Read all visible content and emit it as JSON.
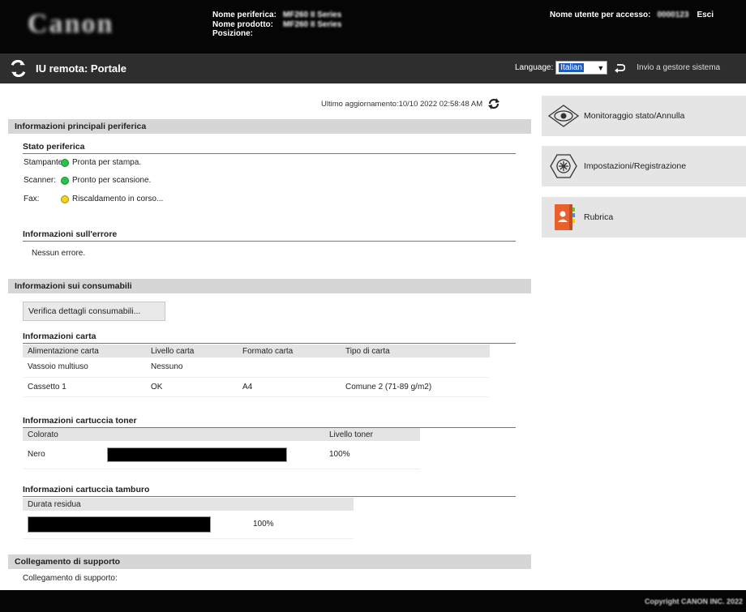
{
  "header": {
    "logo_text": "Canon",
    "device_name_label": "Nome periferica:",
    "device_name_value": "MF260 II Series",
    "product_name_label": "Nome prodotto:",
    "product_name_value": "MF260 II Series",
    "location_label": "Posizione:",
    "user_label": "Nome utente per accesso:",
    "user_value": "0000123",
    "logout": "Esci"
  },
  "titlebar": {
    "title": "IU remota: Portale",
    "language_label": "Language:",
    "language_selected": "Italian",
    "sysadmin_link": "Invio a gestore sistema"
  },
  "main": {
    "last_update": "Ultimo aggiornamento:10/10 2022 02:58:48 AM",
    "device_info": {
      "section_title": "Informazioni principali periferica",
      "status_heading": "Stato periferica",
      "printer_label": "Stampante:",
      "printer_status": "Pronta per stampa.",
      "scanner_label": "Scanner:",
      "scanner_status": "Pronto per scansione.",
      "fax_label": "Fax:",
      "fax_status": "Riscaldamento in corso...",
      "error_heading": "Informazioni sull'errore",
      "error_text": "Nessun errore."
    },
    "consumables": {
      "section_title": "Informazioni sui consumabili",
      "check_button": "Verifica dettagli consumabili...",
      "paper_heading": "Informazioni carta",
      "paper_columns": [
        "Alimentazione carta",
        "Livello carta",
        "Formato carta",
        "Tipo di carta"
      ],
      "paper_rows": [
        [
          "Vassoio multiuso",
          "Nessuno",
          "",
          ""
        ],
        [
          "Cassetto 1",
          "OK",
          "A4",
          "Comune 2 (71-89 g/m2)"
        ]
      ],
      "toner_heading": "Informazioni cartuccia toner",
      "toner_col_color": "Colorato",
      "toner_col_level": "Livello toner",
      "toner_color": "Nero",
      "toner_level": "100%",
      "toner_fraction": 1.0,
      "drum_heading": "Informazioni cartuccia tamburo",
      "drum_col": "Durata residua",
      "drum_level": "100%",
      "drum_fraction": 1.0
    },
    "support": {
      "section_title": "Collegamento di supporto",
      "link_label": "Collegamento di supporto:"
    }
  },
  "side_menu": {
    "status_monitor": "Monitoraggio stato/Annulla",
    "settings": "Impostazioni/Registrazione",
    "address_book": "Rubrica"
  },
  "footer": {
    "copyright": "Copyright CANON INC. 2022"
  }
}
